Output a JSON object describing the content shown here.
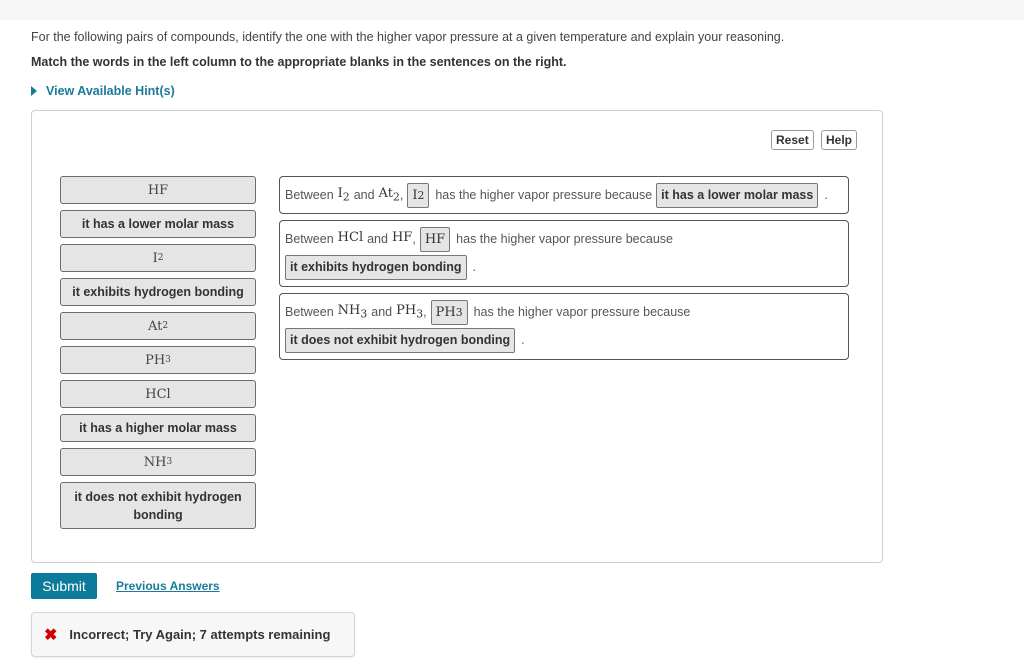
{
  "question": {
    "intro": "For the following pairs of compounds, identify the one with the higher vapor pressure at a given temperature and explain your reasoning.",
    "instruction": "Match the words in the left column to the appropriate blanks in the sentences on the right.",
    "hint_link": "View Available Hint(s)"
  },
  "toolbar": {
    "reset_label": "Reset",
    "help_label": "Help"
  },
  "word_bank": [
    {
      "type": "chem",
      "base": "HF",
      "sub": ""
    },
    {
      "type": "text",
      "label": "it has a lower molar mass"
    },
    {
      "type": "chem",
      "base": "I",
      "sub": "2"
    },
    {
      "type": "text",
      "label": "it exhibits hydrogen bonding"
    },
    {
      "type": "chem",
      "base": "At",
      "sub": "2"
    },
    {
      "type": "chem",
      "base": "PH",
      "sub": "3"
    },
    {
      "type": "chem",
      "base": "HCl",
      "sub": ""
    },
    {
      "type": "text",
      "label": "it has a higher molar mass"
    },
    {
      "type": "chem",
      "base": "NH",
      "sub": "3"
    },
    {
      "type": "text",
      "label": "it does not exhibit hydrogen bonding"
    }
  ],
  "sentences": [
    {
      "between": "Between",
      "compound_a": {
        "base": "I",
        "sub": "2"
      },
      "and": "and",
      "compound_b": {
        "base": "At",
        "sub": "2"
      },
      "answer_compound": {
        "base": "I",
        "sub": "2"
      },
      "middle_text": "has the higher vapor pressure because",
      "answer_reason": "it has a lower molar mass",
      "end": "."
    },
    {
      "between": "Between",
      "compound_a": {
        "base": "HCl",
        "sub": ""
      },
      "and": "and",
      "compound_b": {
        "base": "HF",
        "sub": ""
      },
      "answer_compound": {
        "base": "HF",
        "sub": ""
      },
      "middle_text": "has the higher vapor pressure because",
      "answer_reason": "it exhibits hydrogen bonding",
      "end": "."
    },
    {
      "between": "Between",
      "compound_a": {
        "base": "NH",
        "sub": "3"
      },
      "and": "and",
      "compound_b": {
        "base": "PH",
        "sub": "3"
      },
      "answer_compound": {
        "base": "PH",
        "sub": "3"
      },
      "middle_text": "has the higher vapor pressure because",
      "answer_reason": "it does not exhibit hydrogen bonding",
      "end": "."
    }
  ],
  "actions": {
    "submit_label": "Submit",
    "previous_answers_label": "Previous Answers"
  },
  "feedback": {
    "icon": "✖",
    "message": "Incorrect; Try Again; 7 attempts remaining",
    "icon_color": "#d20000"
  },
  "colors": {
    "accent": "#0c7a9a",
    "link": "#1a7a9a",
    "chip_bg": "#e5e5e5"
  }
}
